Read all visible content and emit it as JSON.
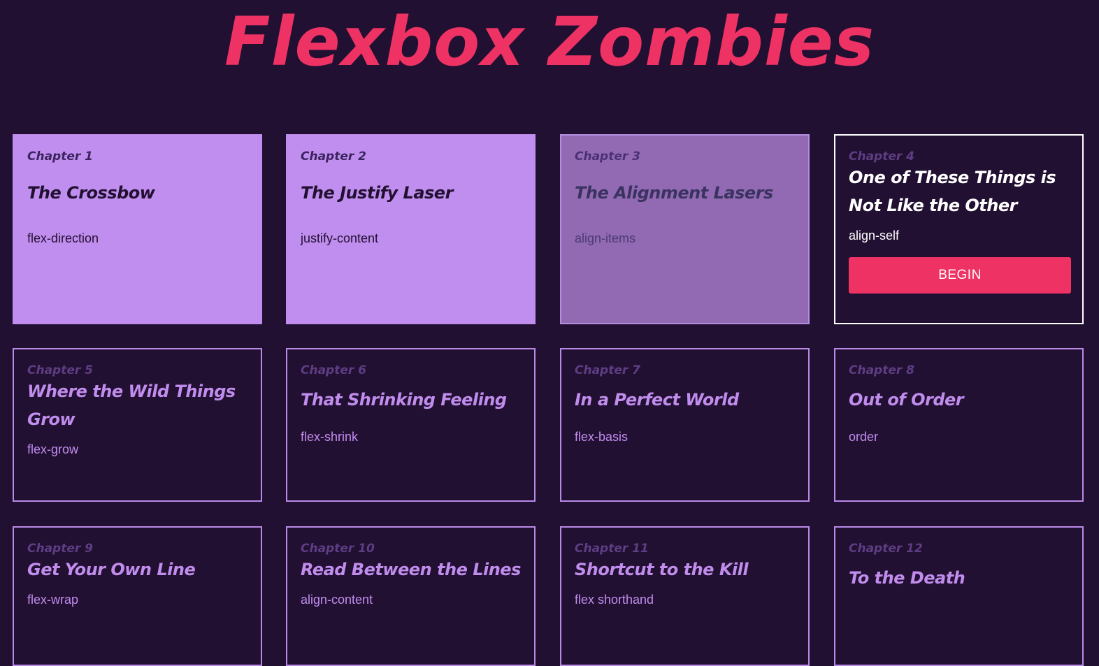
{
  "site": {
    "title": "Flexbox Zombies"
  },
  "chapters": [
    {
      "chapter": "Chapter 1",
      "title": "The Crossbow",
      "topic": "flex-direction",
      "status": "completed"
    },
    {
      "chapter": "Chapter 2",
      "title": "The Justify Laser",
      "topic": "justify-content",
      "status": "completed"
    },
    {
      "chapter": "Chapter 3",
      "title": "The Alignment Lasers",
      "topic": "align-items",
      "status": "completed"
    },
    {
      "chapter": "Chapter 4",
      "title": "One of These Things is Not Like the Other",
      "topic": "align-self",
      "status": "current",
      "button": "BEGIN"
    },
    {
      "chapter": "Chapter 5",
      "title": "Where the Wild Things Grow",
      "topic": "flex-grow",
      "status": "locked"
    },
    {
      "chapter": "Chapter 6",
      "title": "That Shrinking Feeling",
      "topic": "flex-shrink",
      "status": "locked"
    },
    {
      "chapter": "Chapter 7",
      "title": "In a Perfect World",
      "topic": "flex-basis",
      "status": "locked"
    },
    {
      "chapter": "Chapter 8",
      "title": "Out of Order",
      "topic": "order",
      "status": "locked"
    },
    {
      "chapter": "Chapter 9",
      "title": "Get Your Own Line",
      "topic": "flex-wrap",
      "status": "locked"
    },
    {
      "chapter": "Chapter 10",
      "title": "Read Between the Lines",
      "topic": "align-content",
      "status": "locked"
    },
    {
      "chapter": "Chapter 11",
      "title": "Shortcut to the Kill",
      "topic": "flex shorthand",
      "status": "locked"
    },
    {
      "chapter": "Chapter 12",
      "title": "To the Death",
      "topic": "",
      "status": "locked"
    }
  ],
  "colors": {
    "background": "#221033",
    "accent": "#ee3364",
    "lavender": "#c18ded"
  }
}
